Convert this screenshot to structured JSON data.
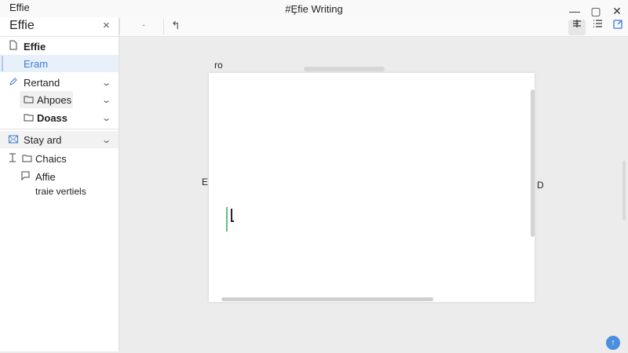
{
  "window": {
    "app_name": "Effie",
    "title": "#Ȩfie Writing",
    "minimize_glyph": "—",
    "maximize_glyph": "▢",
    "close_glyph": "✕"
  },
  "sidebar": {
    "header": "Effie",
    "close_glyph": "×",
    "items": [
      {
        "label": "Effie",
        "icon": "document-icon"
      },
      {
        "label": "Eram",
        "icon": "none"
      },
      {
        "label": "Rertand",
        "icon": "pencil-icon"
      },
      {
        "label": "Ahpoes",
        "icon": "folder-icon"
      },
      {
        "label": "Doass",
        "icon": "folder-icon"
      },
      {
        "label": "Stay ard",
        "icon": "mail-icon"
      },
      {
        "label": "Chaics",
        "icon": "folder-icon"
      },
      {
        "label": "Affie",
        "icon": "note-icon"
      },
      {
        "label": "traie vertiels",
        "icon": "none"
      }
    ]
  },
  "toolbar": {
    "dot_glyph": "·",
    "undo_glyph": "↰"
  },
  "canvas": {
    "top_note": "ro",
    "left_note": "E",
    "right_note": "D"
  },
  "colors": {
    "accent": "#3b7bd4",
    "caret_green": "#5ec47a",
    "fab": "#4a8ee0"
  }
}
